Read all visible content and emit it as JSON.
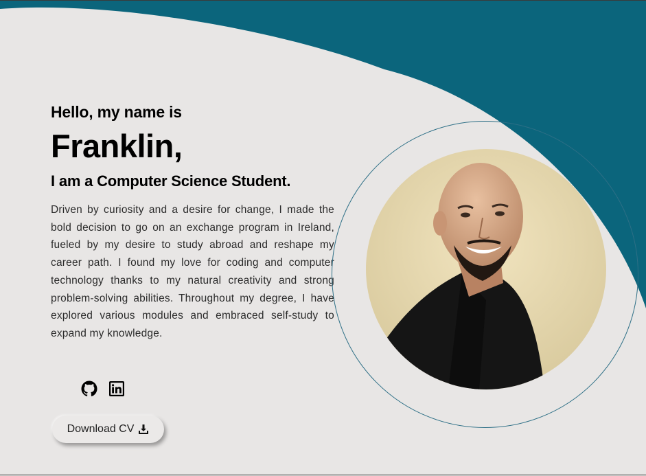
{
  "hero": {
    "greeting": "Hello, my name is",
    "name": "Franklin,",
    "role": "I am a Computer Science Student.",
    "bio": "Driven by curiosity and a desire for change, I made the bold decision to go on an exchange program in Ireland, fueled by my desire to study abroad and reshape my career path. I found my love for coding and computer technology thanks to my natural creativity and strong problem-solving abilities. Throughout my degree, I have explored various modules and embraced self-study to expand my knowledge."
  },
  "socials": [
    {
      "icon": "github-icon"
    },
    {
      "icon": "linkedin-icon"
    }
  ],
  "cv_button": {
    "label": "Download CV",
    "icon": "download-icon"
  },
  "colors": {
    "background": "#e8e6e5",
    "accent": "#0b657c",
    "ring": "#2d6f86",
    "text": "#000000"
  }
}
